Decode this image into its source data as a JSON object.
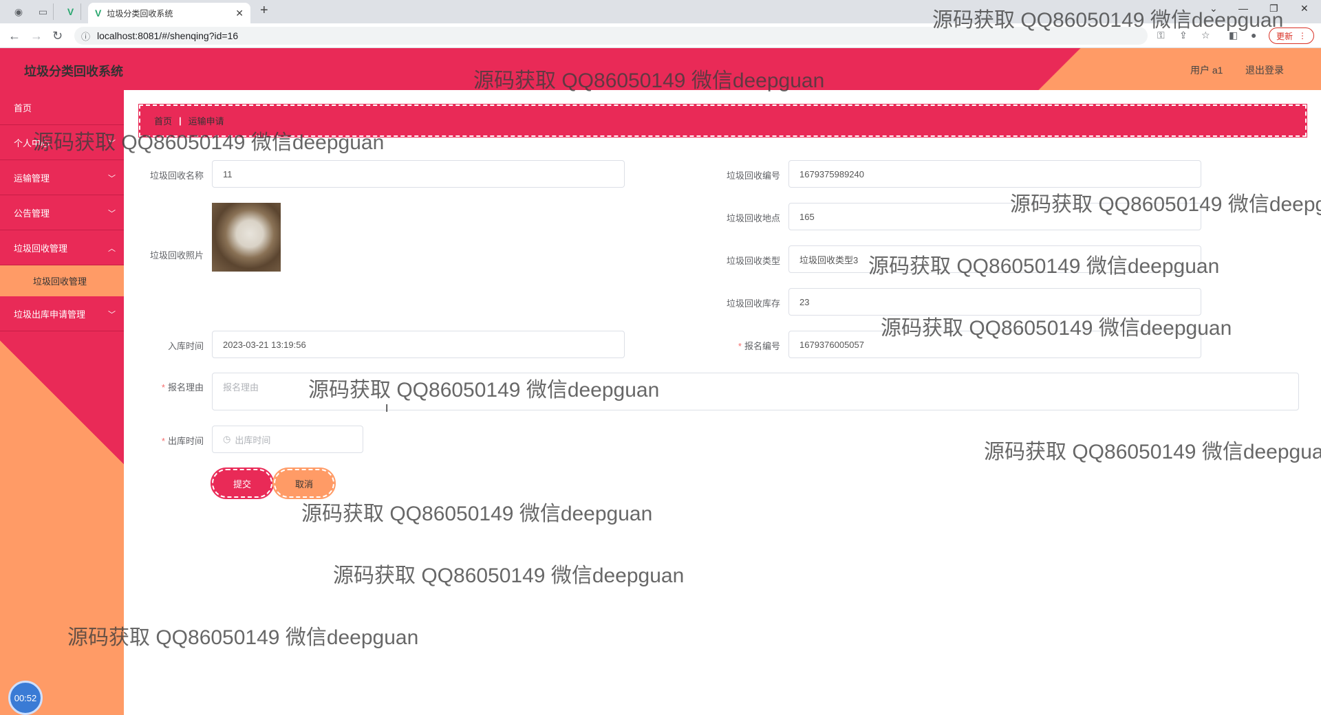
{
  "browser": {
    "tab_title": "垃圾分类回收系统",
    "url": "localhost:8081/#/shenqing?id=16",
    "update_label": "更新"
  },
  "header": {
    "title": "垃圾分类回收系统",
    "user": "用户 a1",
    "logout": "退出登录"
  },
  "sidebar": {
    "items": [
      {
        "label": "首页"
      },
      {
        "label": "个人中心"
      },
      {
        "label": "运输管理"
      },
      {
        "label": "公告管理"
      },
      {
        "label": "垃圾回收管理"
      },
      {
        "label": "垃圾出库申请管理"
      }
    ],
    "subitem": "垃圾回收管理",
    "timer": "00:52"
  },
  "breadcrumb": {
    "home": "首页",
    "current": "运输申请"
  },
  "form": {
    "name_label": "垃圾回收名称",
    "name_value": "11",
    "code_label": "垃圾回收编号",
    "code_value": "1679375989240",
    "photo_label": "垃圾回收照片",
    "location_label": "垃圾回收地点",
    "location_value": "165",
    "type_label": "垃圾回收类型",
    "type_value": "垃圾回收类型3",
    "stock_label": "垃圾回收库存",
    "stock_value": "23",
    "intime_label": "入库时间",
    "intime_value": "2023-03-21 13:19:56",
    "signup_code_label": "报名编号",
    "signup_code_value": "1679376005057",
    "reason_label": "报名理由",
    "reason_placeholder": "报名理由",
    "outtime_label": "出库时间",
    "outtime_placeholder": "出库时间",
    "submit": "提交",
    "cancel": "取消"
  },
  "watermark": "源码获取 QQ86050149 微信deepguan"
}
